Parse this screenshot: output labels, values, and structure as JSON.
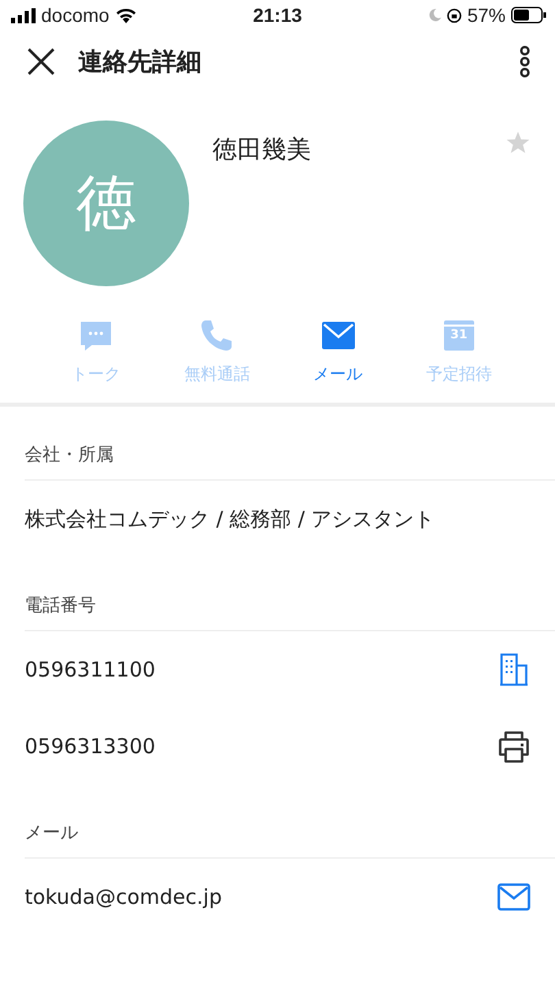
{
  "status_bar": {
    "carrier": "docomo",
    "time": "21:13",
    "battery": "57%"
  },
  "header": {
    "title": "連絡先詳細"
  },
  "contact": {
    "avatar_letter": "徳",
    "name": "徳田幾美",
    "starred": false
  },
  "actions": [
    {
      "kind": "talk",
      "label": "トーク",
      "disabled": true
    },
    {
      "kind": "call",
      "label": "無料通話",
      "disabled": true
    },
    {
      "kind": "mail",
      "label": "メール",
      "disabled": false
    },
    {
      "kind": "calendar",
      "label": "予定招待",
      "icon_text": "31",
      "disabled": true
    }
  ],
  "sections": [
    {
      "title": "会社・所属",
      "rows": [
        {
          "kind": "text",
          "value": "株式会社コムデック / 総務部 / アシスタント"
        }
      ]
    },
    {
      "title": "電話番号",
      "rows": [
        {
          "kind": "office",
          "value": "0596311100"
        },
        {
          "kind": "fax",
          "value": "0596313300"
        }
      ]
    },
    {
      "title": "メール",
      "rows": [
        {
          "kind": "mail",
          "value": "tokuda@comdec.jp"
        }
      ]
    }
  ]
}
